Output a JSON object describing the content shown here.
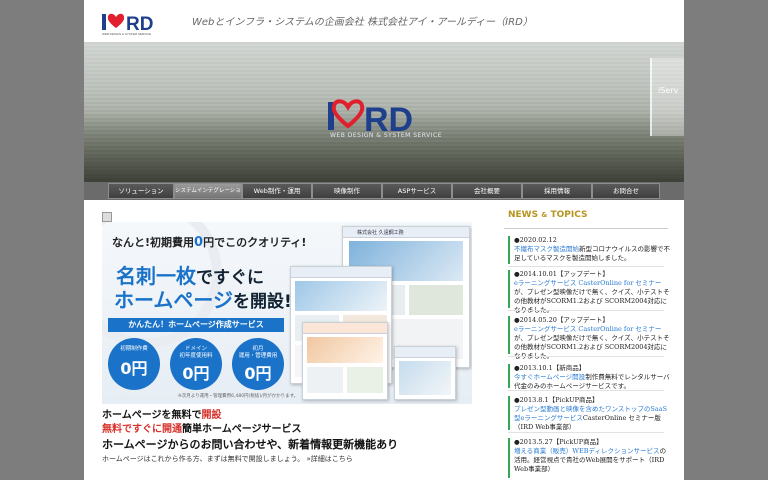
{
  "header": {
    "logo_text": "iRD",
    "logo_sub": "WEB DESIGN & SYSTEM SERVICE",
    "tagline": "Webとインフラ・システムの企画会社 株式会社アイ・アールディー（IRD）"
  },
  "hero": {
    "logo_text": "iRD",
    "subtitle": "WEB DESIGN & SYSTEM SERVICE",
    "thumb_text": "iServ"
  },
  "nav": {
    "items": [
      {
        "label": "ソリューション",
        "active": false
      },
      {
        "label": "システムインテグレーション",
        "active": true
      },
      {
        "label": "Web制作・運用",
        "active": false
      },
      {
        "label": "映像制作",
        "active": false
      },
      {
        "label": "ASPサービス",
        "active": false
      },
      {
        "label": "会社概要",
        "active": false
      },
      {
        "label": "採用情報",
        "active": false
      },
      {
        "label": "お問合せ",
        "active": false
      }
    ]
  },
  "banner": {
    "line1_a": "なんと!初期費用",
    "line1_zero": "0",
    "line1_b": "円でこのクオリティ!",
    "line2_a": "名刺一枚",
    "line2_b": "ですぐに",
    "line3_a": "ホームページ",
    "line3_b": "を開設!!",
    "bar": "かんたん！ホームページ作成サービス",
    "circles": [
      {
        "label": "初期制作費",
        "value": "0円"
      },
      {
        "label": "ドメイン\n初年度使用料",
        "value": "0円"
      },
      {
        "label": "初月\n運用・管理費用",
        "value": "0円"
      }
    ],
    "note": "※次月より運用・管理費用6,480円(税抜)/月がかかります。",
    "screen_title": "株式会社 久遠鋼工務"
  },
  "below": {
    "line1_a": "ホームページを無料で",
    "line1_red": "開設",
    "line2_red": "無料ですぐに開通",
    "line2_b": "簡単ホームページサービス",
    "line3": "ホームページからのお問い合わせや、新着情報更新機能あり",
    "line4": "ホームページはこれから作る方、まずは無料で開設しましょう。 »詳細はこちら"
  },
  "news": {
    "title_a": "NEWS",
    "title_amp": "&",
    "title_b": "TOPICS",
    "items": [
      {
        "date": "●2020.02.12",
        "link": "不織布マスク製造開始",
        "text": "新型コロナウイルスの影響で不足しているマスクを製造開始しました。"
      },
      {
        "date": "●2014.10.01【アップデート】",
        "link": "eラーニングサービス CasterOnline for セミナー",
        "text": "が、プレゼン型映像だけで無く、クイズ、小テストその他教材がSCORM1.2および SCORM2004対応になりました。"
      },
      {
        "date": "●2014.05.20【アップデート】",
        "link": "eラーニングサービス CasterOnline for セミナー",
        "text": "が、プレゼン型映像だけで無く、クイズ、小テストその他教材がSCORM1.2および SCORM2004対応になりました。"
      },
      {
        "date": "●2013.10.1【新商品】",
        "link": "今すぐホームページ開設",
        "text": "制作費無料でレンタルサーバ代金のみのホームページサービスです。"
      },
      {
        "date": "●2013.8.1【PickUP商品】",
        "link": "プレゼン型動画と映像を含めたワンストップのSaaS型eラーニングサービス",
        "text": "CasterOnline セミナー版（IRD Web事業部）"
      },
      {
        "date": "●2013.5.27【PickUP商品】",
        "link": "増える商業（販売）WEBディレクションサービス",
        "text": "の活用。経営視点で貴社のWeb展開をサポート（IRD Web事業部）"
      }
    ]
  }
}
